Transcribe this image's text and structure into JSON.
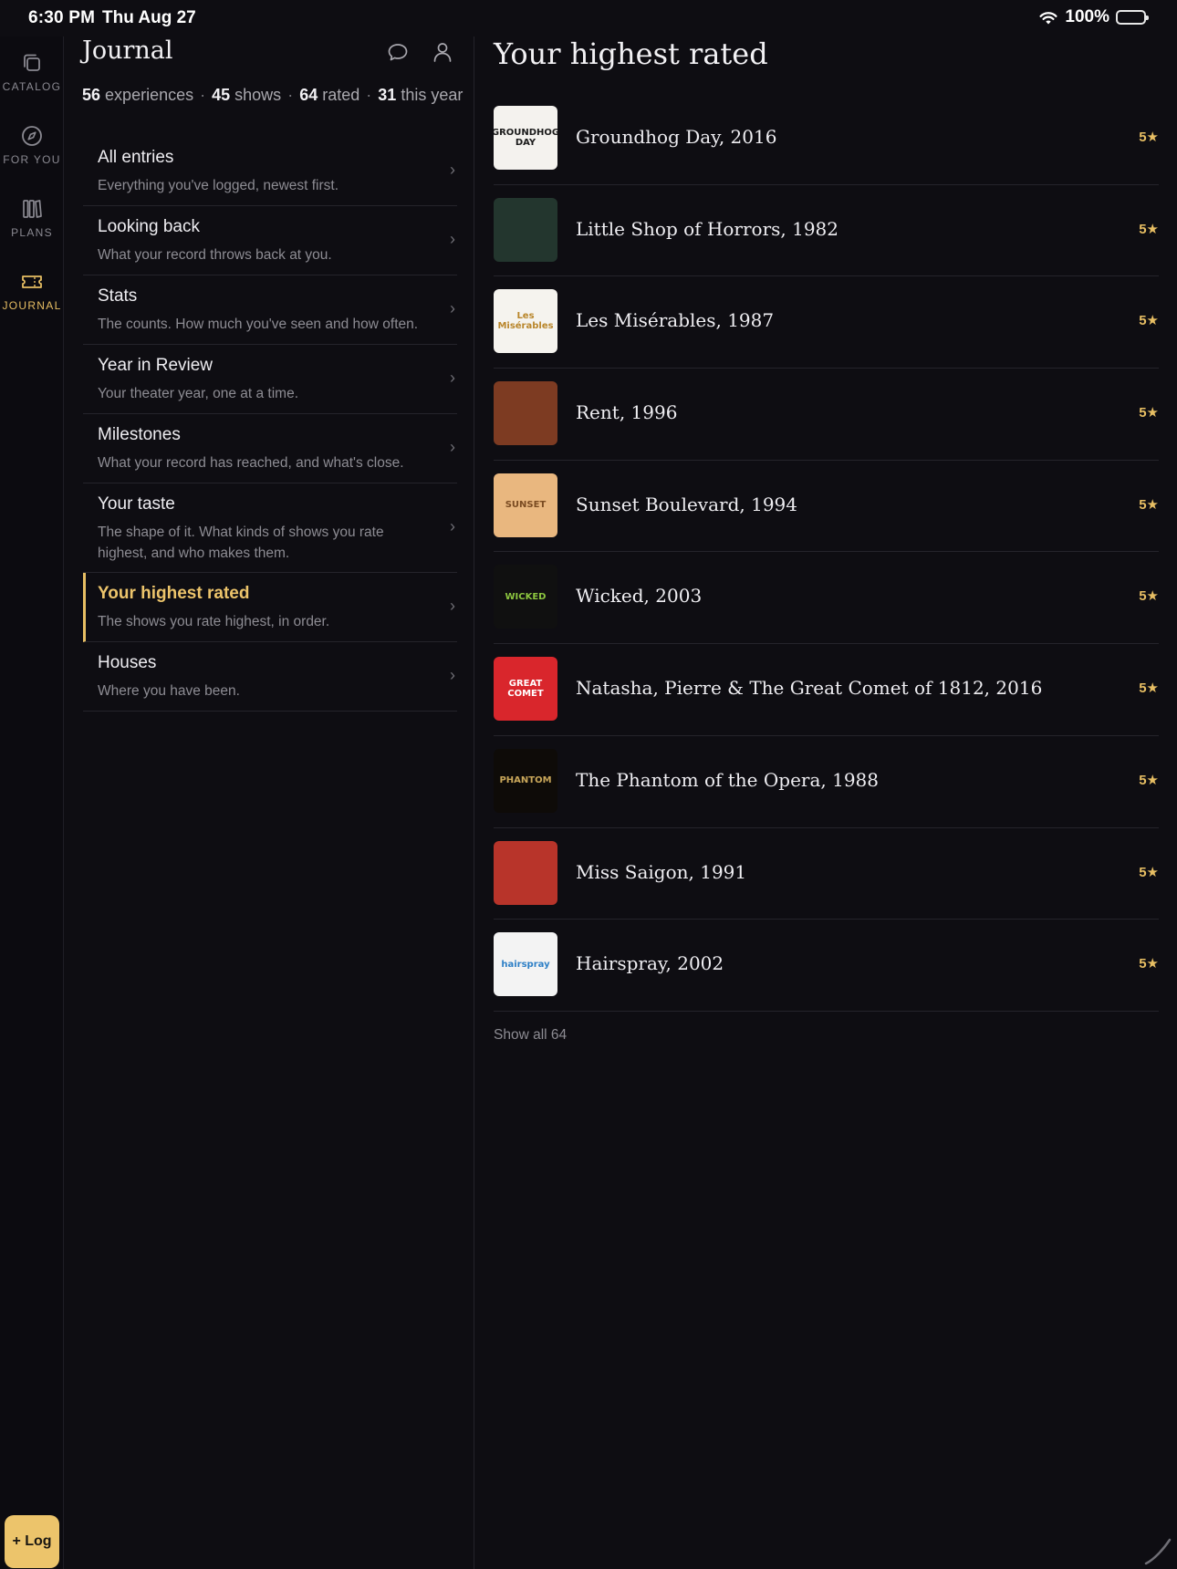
{
  "status_bar": {
    "time": "6:30 PM",
    "date": "Thu Aug 27",
    "battery": "100%"
  },
  "rail": {
    "items": [
      {
        "label": "CATALOG",
        "icon": "catalog-icon"
      },
      {
        "label": "FOR YOU",
        "icon": "compass-icon"
      },
      {
        "label": "PLANS",
        "icon": "books-icon"
      },
      {
        "label": "JOURNAL",
        "icon": "ticket-icon",
        "active": true
      }
    ],
    "log_button": "+ Log"
  },
  "journal": {
    "title": "Journal",
    "stats": [
      {
        "value": "56",
        "label": "experiences"
      },
      {
        "value": "45",
        "label": "shows"
      },
      {
        "value": "64",
        "label": "rated"
      },
      {
        "value": "31",
        "label": "this year"
      }
    ],
    "menu": [
      {
        "title": "All entries",
        "subtitle": "Everything you've logged, newest first."
      },
      {
        "title": "Looking back",
        "subtitle": "What your record throws back at you."
      },
      {
        "title": "Stats",
        "subtitle": "The counts. How much you've seen and how often."
      },
      {
        "title": "Year in Review",
        "subtitle": "Your theater year, one at a time."
      },
      {
        "title": "Milestones",
        "subtitle": "What your record has reached, and what's close."
      },
      {
        "title": "Your taste",
        "subtitle": "The shape of it. What kinds of shows you rate highest, and who makes them."
      },
      {
        "title": "Your highest rated",
        "subtitle": "The shows you rate highest, in order.",
        "active": true
      },
      {
        "title": "Houses",
        "subtitle": "Where you have been."
      }
    ],
    "chevron": "›"
  },
  "highest_rated": {
    "title": "Your highest rated",
    "items": [
      {
        "title": "Groundhog Day, 2016",
        "rating": "5★",
        "art": {
          "bg": "#f4f2ee",
          "fg": "#1b1b1b",
          "text": "GROUNDHOG DAY"
        }
      },
      {
        "title": "Little Shop of Horrors, 1982",
        "rating": "5★",
        "art": {
          "bg": "#23362e",
          "fg": "#c9513d",
          "text": ""
        }
      },
      {
        "title": "Les Misérables, 1987",
        "rating": "5★",
        "art": {
          "bg": "#f5f3ee",
          "fg": "#b9862b",
          "text": "Les Misérables"
        }
      },
      {
        "title": "Rent, 1996",
        "rating": "5★",
        "art": {
          "bg": "#7d3b22",
          "fg": "#d9a24a",
          "text": ""
        }
      },
      {
        "title": "Sunset Boulevard, 1994",
        "rating": "5★",
        "art": {
          "bg": "#e9b77f",
          "fg": "#7a4b22",
          "text": "SUNSET"
        }
      },
      {
        "title": "Wicked, 2003",
        "rating": "5★",
        "art": {
          "bg": "#101010",
          "fg": "#8cc63f",
          "text": "WICKED"
        }
      },
      {
        "title": "Natasha, Pierre & The Great Comet of 1812, 2016",
        "rating": "5★",
        "art": {
          "bg": "#d9262c",
          "fg": "#ffffff",
          "text": "GREAT COMET"
        }
      },
      {
        "title": "The Phantom of the Opera, 1988",
        "rating": "5★",
        "art": {
          "bg": "#0e0b08",
          "fg": "#c9a75a",
          "text": "PHANTOM"
        }
      },
      {
        "title": "Miss Saigon, 1991",
        "rating": "5★",
        "art": {
          "bg": "#b8342a",
          "fg": "#f5c431",
          "text": ""
        }
      },
      {
        "title": "Hairspray, 2002",
        "rating": "5★",
        "art": {
          "bg": "#f3f3f3",
          "fg": "#2d7fc6",
          "text": "hairspray"
        }
      }
    ],
    "show_all": "Show all 64"
  },
  "colors": {
    "accent": "#e7be63",
    "background": "#0e0d12",
    "text": "#ecebef",
    "muted": "#8d8c93"
  }
}
